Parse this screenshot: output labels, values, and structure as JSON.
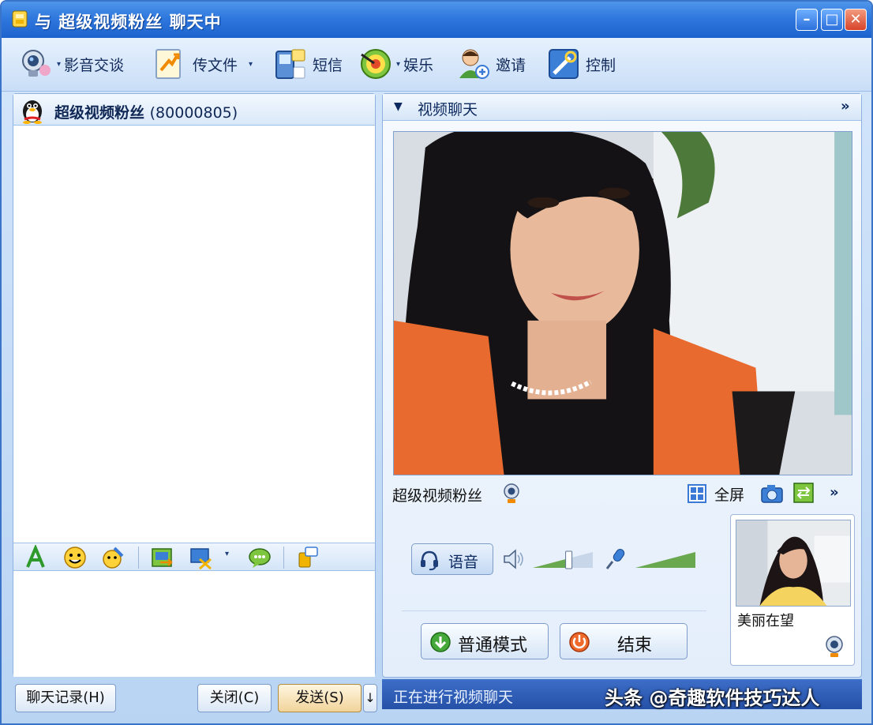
{
  "window": {
    "title": "与 超级视频粉丝 聊天中",
    "controls": {
      "minimize": "–",
      "maximize": "□",
      "close": "✕"
    }
  },
  "toolbar": {
    "items": [
      {
        "label": "影音交谈",
        "icon": "webcam-icon",
        "has_dropdown": true
      },
      {
        "label": "传文件",
        "icon": "file-transfer-icon",
        "has_dropdown": true
      },
      {
        "label": "短信",
        "icon": "mobile-sms-icon",
        "has_dropdown": false
      },
      {
        "label": "娱乐",
        "icon": "target-icon",
        "has_dropdown": true
      },
      {
        "label": "邀请",
        "icon": "invite-user-icon",
        "has_dropdown": false
      },
      {
        "label": "控制",
        "icon": "remote-control-icon",
        "has_dropdown": false
      }
    ],
    "caret": "▾"
  },
  "contact": {
    "name": "超级视频粉丝",
    "id": "(80000805)"
  },
  "chat": {
    "format_tools": [
      "font-icon",
      "emoticon-icon",
      "magic-emoticon-icon",
      "screenshot-icon",
      "screen-capture-icon",
      "chat-bubble-icon",
      "message-mode-icon"
    ]
  },
  "buttons": {
    "history": "聊天记录(H)",
    "close": "关闭(C)",
    "send": "发送(S)",
    "send_options": "↓"
  },
  "video": {
    "header_arrow": "▼",
    "header_title": "视频聊天",
    "header_more": "»",
    "remote_name": "超级视频粉丝",
    "fullscreen": "全屏",
    "more": "»",
    "voice_label": "语音",
    "normal_mode": "普通模式",
    "end": "结束",
    "self_name": "美丽在望",
    "speaker_volume_fraction": 0.6,
    "mic_volume_fraction": 1.0
  },
  "status": {
    "text": "正在进行视频聊天"
  },
  "watermark": "头条 @奇趣软件技巧达人",
  "colors": {
    "titlebar": "#2f78de",
    "statusbar": "#2550a7",
    "accent": "#3a74c9"
  }
}
